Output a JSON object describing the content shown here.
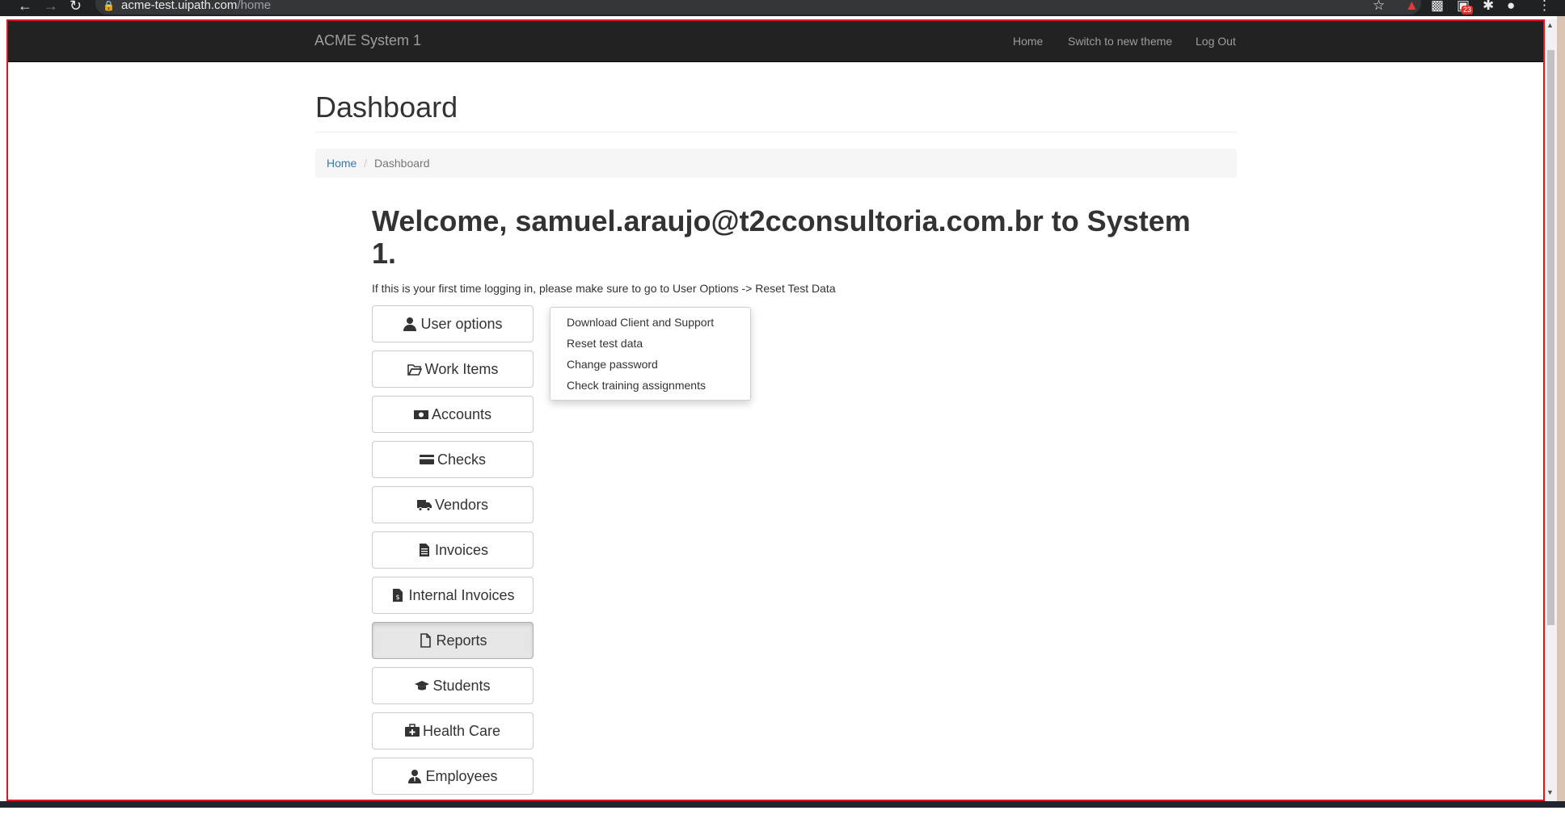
{
  "browser": {
    "url_host": "acme-test.uipath.com",
    "url_path": "/home",
    "extension_badge": "23"
  },
  "navbar": {
    "brand": "ACME System 1",
    "links": [
      "Home",
      "Switch to new theme",
      "Log Out"
    ]
  },
  "page": {
    "title": "Dashboard",
    "breadcrumb": {
      "home": "Home",
      "separator": "/",
      "current": "Dashboard"
    }
  },
  "welcome": {
    "prefix": "Welcome, ",
    "user": "samuel.araujo@t2cconsultoria.com.br",
    "suffix": " to System 1.",
    "note": "If this is your first time logging in, please make sure to go to User Options -> Reset Test Data"
  },
  "menu": [
    {
      "label": "User options",
      "icon": "user-icon"
    },
    {
      "label": "Work Items",
      "icon": "folder-open-icon"
    },
    {
      "label": "Accounts",
      "icon": "money-icon"
    },
    {
      "label": "Checks",
      "icon": "credit-card-icon"
    },
    {
      "label": "Vendors",
      "icon": "truck-icon"
    },
    {
      "label": "Invoices",
      "icon": "file-text-icon"
    },
    {
      "label": "Internal Invoices",
      "icon": "file-invoice-dollar-icon"
    },
    {
      "label": "Reports",
      "icon": "file-icon"
    },
    {
      "label": "Students",
      "icon": "graduation-cap-icon"
    },
    {
      "label": "Health Care",
      "icon": "medkit-icon"
    },
    {
      "label": "Employees",
      "icon": "user-tie-icon"
    }
  ],
  "dropdown": {
    "items": [
      "Download Client and Support",
      "Reset test data",
      "Change password",
      "Check training assignments"
    ]
  },
  "colors": {
    "navbar_bg": "#222222",
    "link_blue": "#337ab7",
    "frame_red": "#e0141e"
  }
}
